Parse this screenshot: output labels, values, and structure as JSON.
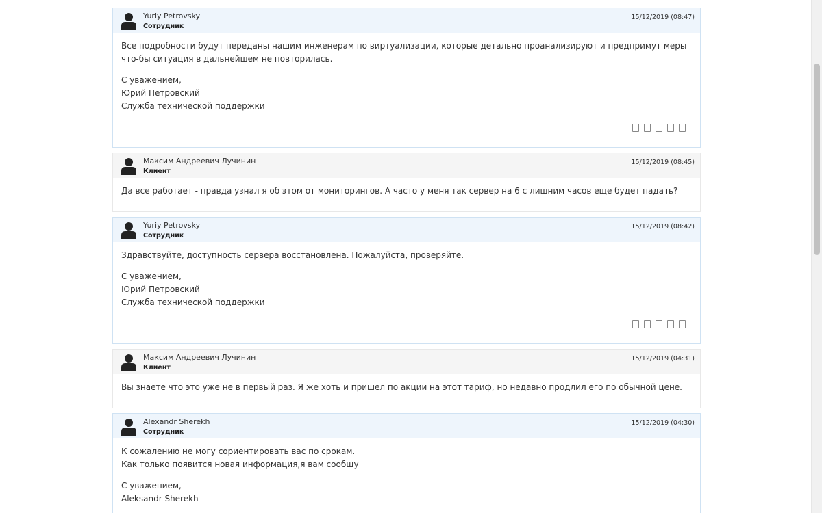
{
  "replies": [
    {
      "author": "Yuriy Petrovsky",
      "role": "Сотрудник",
      "date": "15/12/2019 (08:47)",
      "type": "staff",
      "paragraphs": [
        [
          "Все подробности будут переданы нашим инженерам по виртуализации, которые детально проанализируют и предпримут меры что-бы ситуация в дальнейшем не повторилась."
        ],
        [
          "С уважением,",
          "Юрий Петровский",
          "Служба технической поддержки"
        ]
      ],
      "rating": true
    },
    {
      "author": "Максим Андреевич Лучинин",
      "role": "Клиент",
      "date": "15/12/2019 (08:45)",
      "type": "client",
      "paragraphs": [
        [
          "Да все работает - правда узнал я об этом от мониторингов. А часто у меня так сервер на 6 с лишним часов еще будет падать?"
        ]
      ],
      "rating": false
    },
    {
      "author": "Yuriy Petrovsky",
      "role": "Сотрудник",
      "date": "15/12/2019 (08:42)",
      "type": "staff",
      "paragraphs": [
        [
          "Здравствуйте, доступность сервера восстановлена. Пожалуйста, проверяйте."
        ],
        [
          "С уважением,",
          "Юрий Петровский",
          "Служба технической поддержки"
        ]
      ],
      "rating": true
    },
    {
      "author": "Максим Андреевич Лучинин",
      "role": "Клиент",
      "date": "15/12/2019 (04:31)",
      "type": "client",
      "paragraphs": [
        [
          "Вы знаете что это уже не в первый раз. Я же хоть и пришел по акции на этот тариф, но недавно продлил его по обычной цене."
        ]
      ],
      "rating": false
    },
    {
      "author": "Alexandr Sherekh",
      "role": "Сотрудник",
      "date": "15/12/2019 (04:30)",
      "type": "staff",
      "paragraphs": [
        [
          "К сожалению не могу сориентировать вас по срокам.",
          "Как только появится новая информация,я вам сообщу"
        ],
        [
          "С уважением,",
          "Aleksandr Sherekh"
        ]
      ],
      "rating": false
    }
  ],
  "icons": {
    "avatar": "user-avatar-icon",
    "rating": "rating-star-icon"
  },
  "colors": {
    "staff_header": "#eef5fc",
    "client_header": "#f5f5f5",
    "staff_border": "#cfe2f3"
  },
  "scroll": {
    "position_fraction": 0.12
  }
}
